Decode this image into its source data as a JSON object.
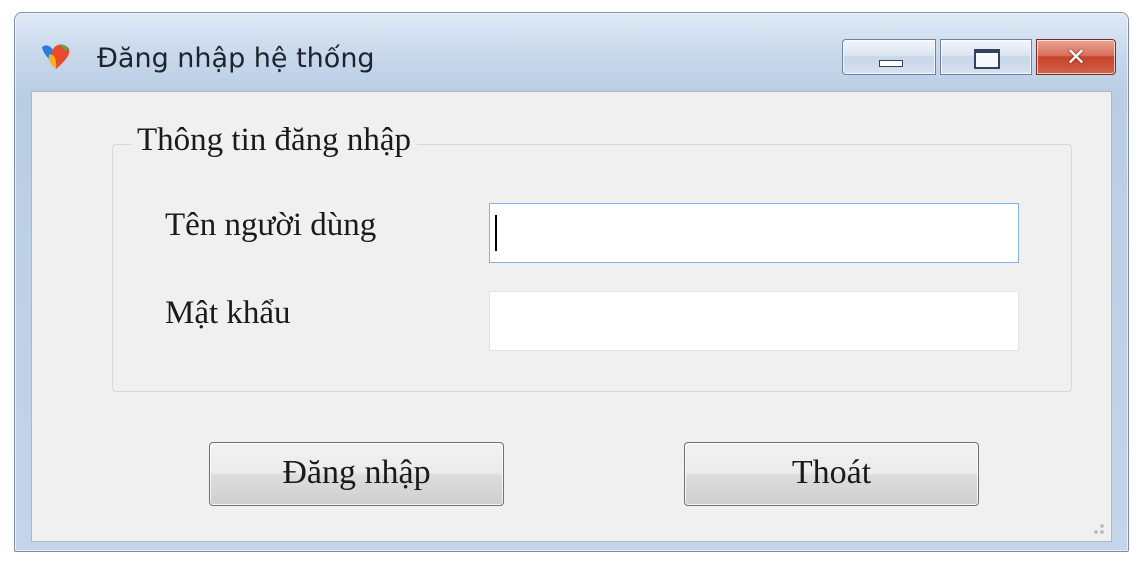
{
  "window": {
    "title": "Đăng nhập hệ thống",
    "icon": "app-logo-icon",
    "controls": {
      "minimize_icon": "minimize-icon",
      "maximize_icon": "maximize-icon",
      "close_icon": "close-icon",
      "close_glyph": "✕"
    }
  },
  "login_group": {
    "legend": "Thông tin đăng nhập",
    "username": {
      "label": "Tên người dùng",
      "value": "",
      "focused": true
    },
    "password": {
      "label": "Mật khẩu",
      "value": ""
    }
  },
  "actions": {
    "login_label": "Đăng nhập",
    "exit_label": "Thoát"
  },
  "colors": {
    "titlebar": "#c9d9ec",
    "client_background": "#f0f0f0",
    "close_button": "#c5432b",
    "input_focus_border": "#7eb4ea"
  }
}
